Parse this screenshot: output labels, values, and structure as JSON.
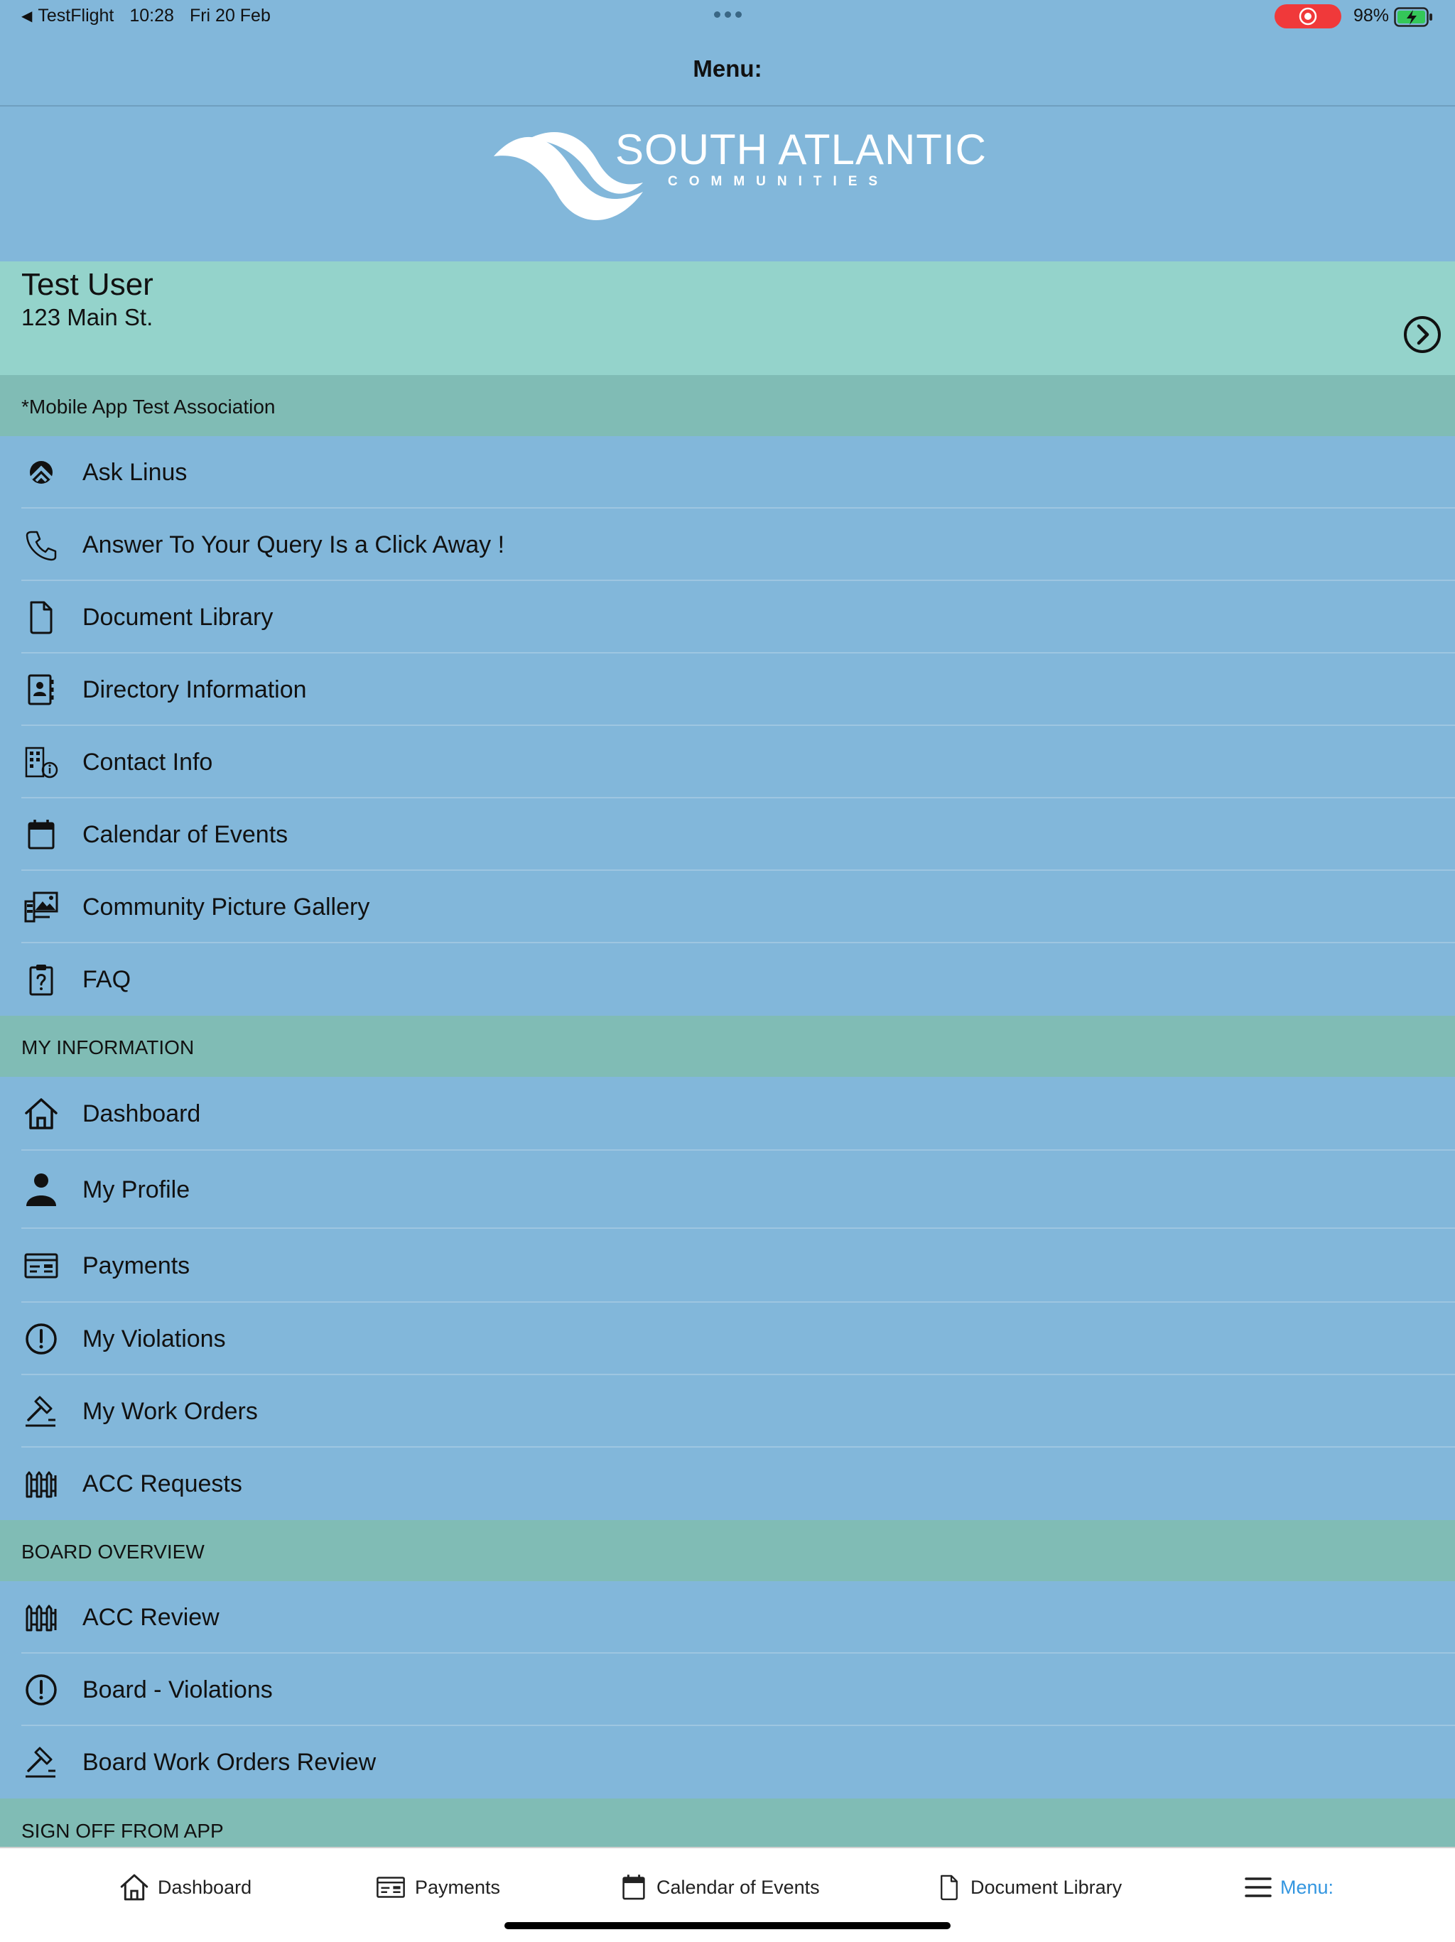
{
  "status_bar": {
    "back_app": "TestFlight",
    "time": "10:28",
    "date": "Fri 20 Feb",
    "battery": "98%"
  },
  "nav": {
    "title": "Menu:"
  },
  "brand": {
    "name": "SOUTH ATLANTIC",
    "sub": "COMMUNITIES"
  },
  "user": {
    "name": "Test User",
    "address": "123 Main St."
  },
  "sections": {
    "association": "*Mobile App Test Association",
    "my_information": "MY INFORMATION",
    "board_overview": "BOARD OVERVIEW",
    "sign_off": "SIGN OFF FROM APP"
  },
  "association_items": [
    {
      "label": "Ask Linus",
      "icon": "linus-icon"
    },
    {
      "label": "Answer To Your Query Is a Click Away !",
      "icon": "phone-icon"
    },
    {
      "label": "Document Library",
      "icon": "document-icon"
    },
    {
      "label": "Directory Information",
      "icon": "contact-book-icon"
    },
    {
      "label": "Contact Info",
      "icon": "building-info-icon"
    },
    {
      "label": "Calendar of Events",
      "icon": "calendar-icon"
    },
    {
      "label": "Community Picture Gallery",
      "icon": "gallery-icon"
    },
    {
      "label": "FAQ",
      "icon": "clipboard-question-icon"
    }
  ],
  "my_information_items": [
    {
      "label": "Dashboard",
      "icon": "home-icon"
    },
    {
      "label": "My Profile",
      "icon": "person-icon"
    },
    {
      "label": "Payments",
      "icon": "payment-card-icon"
    },
    {
      "label": "My Violations",
      "icon": "alert-circle-icon"
    },
    {
      "label": "My Work Orders",
      "icon": "hammer-icon"
    },
    {
      "label": "ACC Requests",
      "icon": "fence-icon"
    }
  ],
  "board_items": [
    {
      "label": "ACC Review",
      "icon": "fence-icon"
    },
    {
      "label": "Board - Violations",
      "icon": "alert-circle-icon"
    },
    {
      "label": "Board Work Orders Review",
      "icon": "hammer-icon"
    }
  ],
  "tabs": [
    {
      "label": "Dashboard",
      "icon": "home-icon"
    },
    {
      "label": "Payments",
      "icon": "payment-card-icon"
    },
    {
      "label": "Calendar of Events",
      "icon": "calendar-icon"
    },
    {
      "label": "Document Library",
      "icon": "document-icon"
    },
    {
      "label": "Menu:",
      "icon": "hamburger-icon",
      "active": true
    }
  ],
  "colors": {
    "background": "#82b7da",
    "user_card": "#94d3cb",
    "section_header": "#80bcb5",
    "tab_active": "#3396e0",
    "record_indicator": "#f0393a"
  }
}
